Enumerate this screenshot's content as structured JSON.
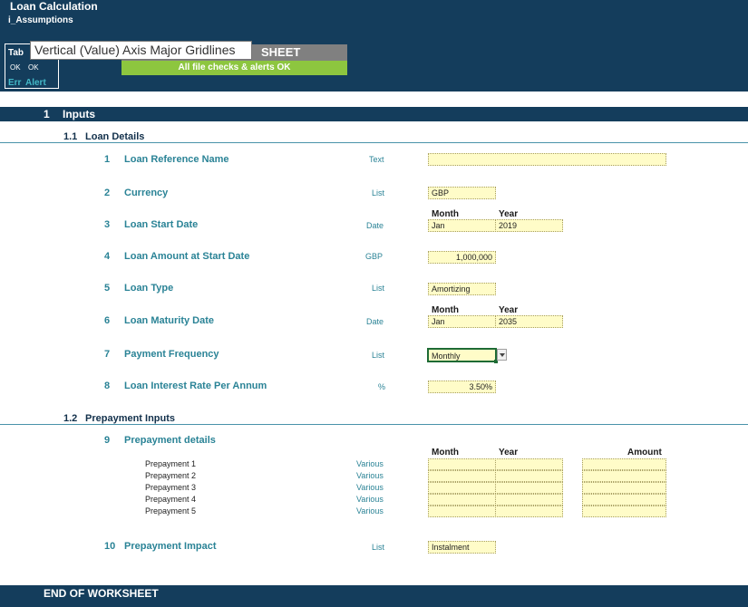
{
  "sheet": {
    "title": "Loan Calculation",
    "tab_name": "i_Assumptions",
    "tab_check": {
      "header": "Tab",
      "status1": "OK",
      "status2": "OK",
      "err": "Err",
      "alert": "Alert"
    },
    "sheet_bar_label": "SHEET",
    "checks_message": "All file checks & alerts OK",
    "tooltip": "Vertical (Value) Axis Major Gridlines",
    "end_label": "END OF WORKSHEET",
    "colors": {
      "band": "#143d5c",
      "accent_green": "#8dc63f",
      "input_fill": "#fffcc8",
      "teal": "#2a8396"
    }
  },
  "section": {
    "num": "1",
    "title": "Inputs"
  },
  "sub1": {
    "num": "1.1",
    "title": "Loan Details"
  },
  "sub2": {
    "num": "1.2",
    "title": "Prepayment Inputs"
  },
  "date_headers": {
    "month": "Month",
    "year": "Year",
    "amount": "Amount"
  },
  "items": [
    {
      "num": "1",
      "label": "Loan Reference Name",
      "unit": "Text",
      "value": ""
    },
    {
      "num": "2",
      "label": "Currency",
      "unit": "List",
      "value": "GBP"
    },
    {
      "num": "3",
      "label": "Loan Start Date",
      "unit": "Date",
      "month": "Jan",
      "year": "2019"
    },
    {
      "num": "4",
      "label": "Loan Amount at Start Date",
      "unit": "GBP",
      "value": "1,000,000"
    },
    {
      "num": "5",
      "label": "Loan Type",
      "unit": "List",
      "value": "Amortizing"
    },
    {
      "num": "6",
      "label": "Loan Maturity Date",
      "unit": "Date",
      "month": "Jan",
      "year": "2035"
    },
    {
      "num": "7",
      "label": "Payment Frequency",
      "unit": "List",
      "value": "Monthly"
    },
    {
      "num": "8",
      "label": "Loan Interest Rate Per Annum",
      "unit": "%",
      "value": "3.50%"
    },
    {
      "num": "9",
      "label": "Prepayment details"
    },
    {
      "num": "10",
      "label": "Prepayment Impact",
      "unit": "List",
      "value": "Instalment"
    }
  ],
  "prepayments": [
    {
      "label": "Prepayment 1",
      "unit": "Various",
      "month": "",
      "year": "",
      "amount": ""
    },
    {
      "label": "Prepayment 2",
      "unit": "Various",
      "month": "",
      "year": "",
      "amount": ""
    },
    {
      "label": "Prepayment 3",
      "unit": "Various",
      "month": "",
      "year": "",
      "amount": ""
    },
    {
      "label": "Prepayment 4",
      "unit": "Various",
      "month": "",
      "year": "",
      "amount": ""
    },
    {
      "label": "Prepayment 5",
      "unit": "Various",
      "month": "",
      "year": "",
      "amount": ""
    }
  ]
}
